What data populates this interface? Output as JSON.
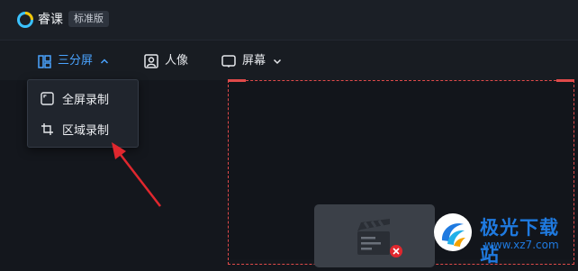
{
  "app": {
    "name": "睿课",
    "edition": "标准版"
  },
  "toolbar": {
    "modes": [
      {
        "label": "三分屏",
        "icon": "layout-icon",
        "expanded": true
      },
      {
        "label": "人像",
        "icon": "portrait-icon"
      },
      {
        "label": "屏幕",
        "icon": "screen-icon"
      }
    ]
  },
  "dropdown": {
    "items": [
      {
        "label": "全屏录制",
        "icon": "fullscreen-icon"
      },
      {
        "label": "区域录制",
        "icon": "crop-icon"
      }
    ]
  },
  "watermark": {
    "brand": "极光下载站",
    "url": "www.xz7.com"
  },
  "colors": {
    "accent": "#4aa3ff",
    "selection_border": "#e04a4a",
    "annotation_arrow": "#e0272e",
    "watermark": "#1f7ae0"
  }
}
